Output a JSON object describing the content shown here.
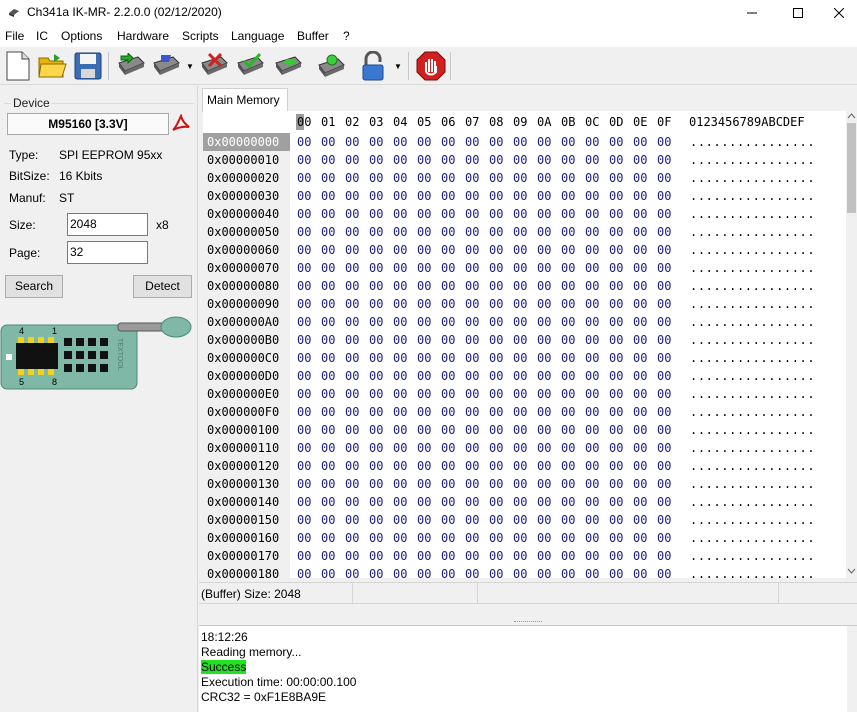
{
  "window": {
    "title": "Ch341a IK-MR- 2.2.0.0 (02/12/2020)"
  },
  "menu": [
    "File",
    "IC",
    "Options",
    "Hardware",
    "Scripts",
    "Language",
    "Buffer",
    "?"
  ],
  "toolbar": {
    "icons": [
      "new-file-icon",
      "open-folder-icon",
      "save-icon",
      "read-chip-icon",
      "write-chip-icon",
      "erase-chip-icon",
      "verify-chip-icon",
      "blank-check-icon",
      "auto-icon",
      "lock-icon",
      "stop-icon"
    ]
  },
  "device": {
    "group_label": "Device",
    "chip": "M95160 [3.3V]",
    "type_label": "Type:",
    "type_value": "SPI EEPROM 95xx",
    "bitsize_label": "BitSize:",
    "bitsize_value": "16 Kbits",
    "manuf_label": "Manuf:",
    "manuf_value": "ST",
    "size_label": "Size:",
    "size_value": "2048",
    "size_unit": "x8",
    "page_label": "Page:",
    "page_value": "32",
    "search_button": "Search",
    "detect_button": "Detect",
    "socket": {
      "pin_top_left": "4",
      "pin_top_right": "1",
      "pin_bottom_left": "5",
      "pin_bottom_right": "8",
      "brand": "TEXTOOL"
    }
  },
  "memory": {
    "tab": "Main Memory",
    "columns": [
      "00",
      "01",
      "02",
      "03",
      "04",
      "05",
      "06",
      "07",
      "08",
      "09",
      "0A",
      "0B",
      "0C",
      "0D",
      "0E",
      "0F"
    ],
    "ascii_header": "0123456789ABCDEF",
    "fill_byte": "00",
    "ascii_fill": "................",
    "rows": [
      "0x00000000",
      "0x00000010",
      "0x00000020",
      "0x00000030",
      "0x00000040",
      "0x00000050",
      "0x00000060",
      "0x00000070",
      "0x00000080",
      "0x00000090",
      "0x000000A0",
      "0x000000B0",
      "0x000000C0",
      "0x000000D0",
      "0x000000E0",
      "0x000000F0",
      "0x00000100",
      "0x00000110",
      "0x00000120",
      "0x00000130",
      "0x00000140",
      "0x00000150",
      "0x00000160",
      "0x00000170",
      "0x00000180"
    ],
    "selected_row": 0
  },
  "status": {
    "buffer_size": "(Buffer) Size: 2048"
  },
  "log": {
    "lines": [
      "18:12:26",
      "Reading memory...",
      "Success",
      "Execution time: 00:00:00.100",
      "CRC32 = 0xF1E8BA9E"
    ],
    "success_index": 2
  },
  "colors": {
    "hex_value": "#1a1a8c",
    "success_bg": "#22e022",
    "stop_red": "#d21f1f"
  }
}
